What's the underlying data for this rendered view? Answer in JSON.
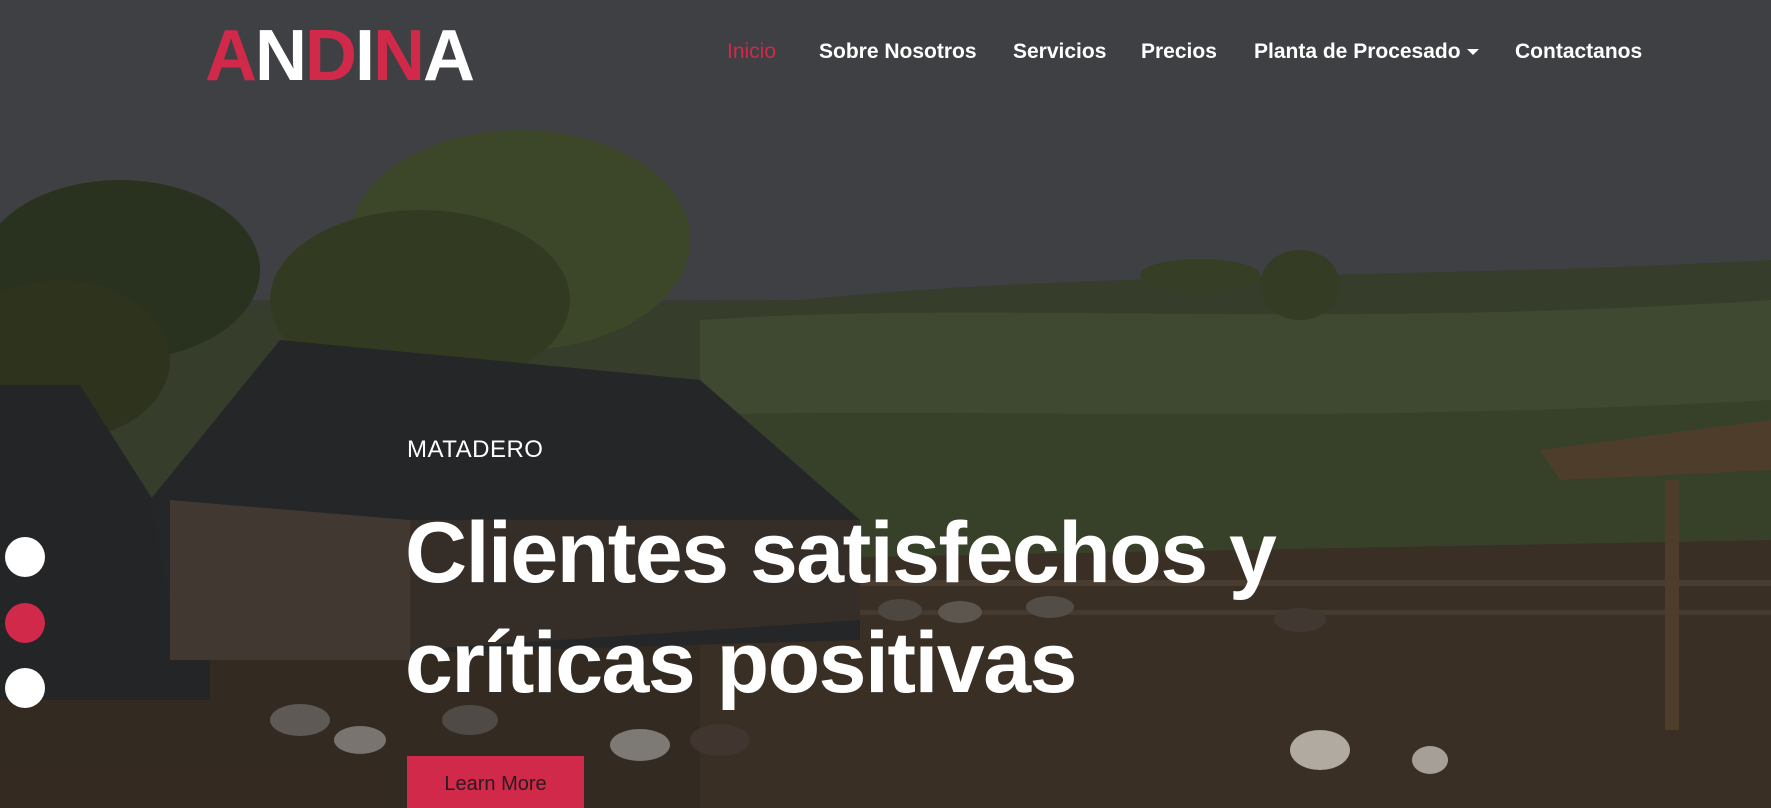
{
  "brand": {
    "logo_parts": [
      {
        "text": "A",
        "color": "red"
      },
      {
        "text": "N",
        "color": "white"
      },
      {
        "text": "D",
        "color": "red"
      },
      {
        "text": "I",
        "color": "white"
      },
      {
        "text": "N",
        "color": "red"
      },
      {
        "text": "A",
        "color": "white"
      }
    ]
  },
  "nav": {
    "items": [
      {
        "label": "Inicio",
        "active": true
      },
      {
        "label": "Sobre Nosotros",
        "active": false
      },
      {
        "label": "Servicios",
        "active": false
      },
      {
        "label": "Precios",
        "active": false
      },
      {
        "label": "Planta de Procesado",
        "active": false,
        "has_dropdown": true
      },
      {
        "label": "Contactanos",
        "active": false
      }
    ]
  },
  "hero": {
    "eyebrow": "MATADERO",
    "headline_line1": "Clientes satisfechos y",
    "headline_line2": "críticas positivas",
    "cta_label": "Learn More",
    "background_scene": "farm with wooden barns, fenced livestock pen with sheep and goats, green hills"
  },
  "carousel": {
    "slide_count": 3,
    "active_index": 1
  },
  "colors": {
    "accent": "#d0294a",
    "text": "#ffffff"
  },
  "icons": {
    "dropdown": "caret-down-icon"
  }
}
